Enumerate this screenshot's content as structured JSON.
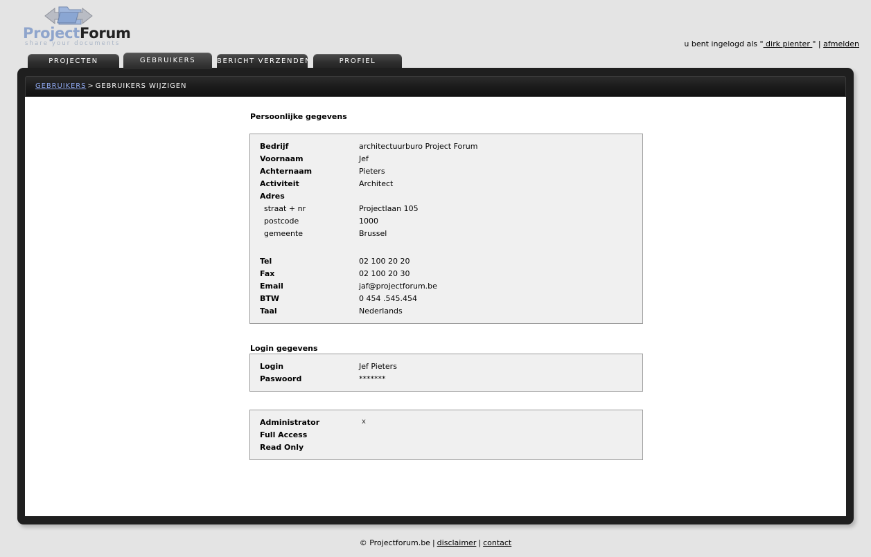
{
  "brand": {
    "name_part1": "Project",
    "name_part2": "Forum",
    "tagline": "share  your documents",
    "logo_icon": "folder-exchange-icon"
  },
  "header": {
    "login_status_prefix": "u bent ingelogd als \"",
    "login_username": " dirk pienter ",
    "login_status_suffix": "\"",
    "separator": "|",
    "logout_label": "afmelden"
  },
  "tabs": [
    {
      "label": "PROJECTEN",
      "active": false
    },
    {
      "label": "GEBRUIKERS",
      "active": true
    },
    {
      "label": "BERICHT VERZENDEN",
      "active": false
    },
    {
      "label": "PROFIEL",
      "active": false
    }
  ],
  "breadcrumb": {
    "parent_label": "GEBRUIKERS",
    "separator": ">",
    "current_label": "GEBRUIKERS WIJZIGEN"
  },
  "personal": {
    "title": "Persoonlijke gegevens",
    "rows": [
      {
        "label": "Bedrijf",
        "value": "architectuurburo Project Forum",
        "sub": false
      },
      {
        "label": "Voornaam",
        "value": "Jef",
        "sub": false
      },
      {
        "label": "Achternaam",
        "value": "Pieters",
        "sub": false
      },
      {
        "label": "Activiteit",
        "value": "Architect",
        "sub": false
      },
      {
        "label": "Adres",
        "value": "",
        "sub": false
      },
      {
        "label": "straat + nr",
        "value": "Projectlaan 105",
        "sub": true
      },
      {
        "label": "postcode",
        "value": "1000",
        "sub": true
      },
      {
        "label": "gemeente",
        "value": "Brussel",
        "sub": true
      },
      {
        "label": "",
        "value": "",
        "sub": false,
        "spacer": true
      },
      {
        "label": "Tel",
        "value": "02 100 20 20",
        "sub": false
      },
      {
        "label": "Fax",
        "value": "02 100 20 30",
        "sub": false
      },
      {
        "label": "Email",
        "value": "jaf@projectforum.be",
        "sub": false
      },
      {
        "label": "BTW",
        "value": "0 454 .545.454",
        "sub": false
      },
      {
        "label": "Taal",
        "value": "Nederlands",
        "sub": false
      }
    ]
  },
  "login": {
    "title": "Login gegevens",
    "rows": [
      {
        "label": "Login",
        "value": "Jef Pieters"
      },
      {
        "label": "Paswoord",
        "value": "*******"
      }
    ]
  },
  "rights": {
    "rows": [
      {
        "label": "Administrator",
        "value": "x"
      },
      {
        "label": "Full Access",
        "value": ""
      },
      {
        "label": "Read Only",
        "value": ""
      }
    ]
  },
  "footer": {
    "copyright": "© Projectforum.be",
    "sep1": "|",
    "disclaimer_label": "disclaimer",
    "sep2": "|",
    "contact_label": "contact"
  },
  "colors": {
    "page_bg": "#e4e4e4",
    "frame_dark": "#1f1f1f",
    "panel_bg": "#f0f0f0",
    "panel_border": "#9a9a9a",
    "link_blue": "#8fa8ef",
    "brand_blue": "#8fa5cc"
  }
}
